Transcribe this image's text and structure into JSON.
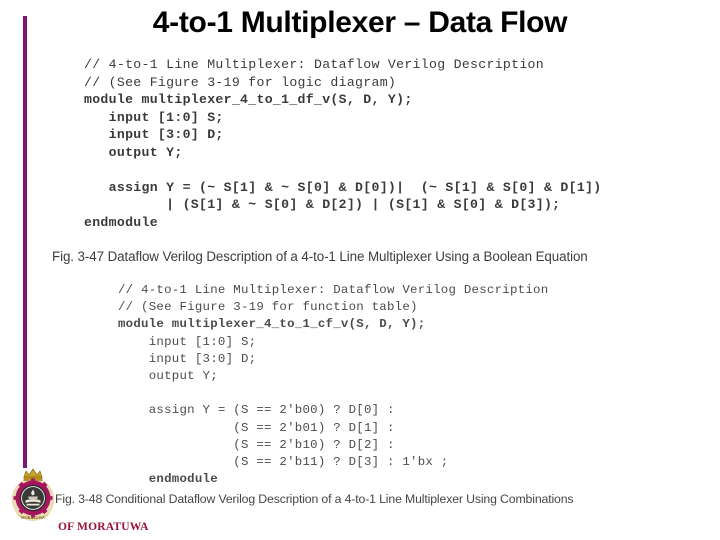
{
  "slide": {
    "title": "4-to-1 Multiplexer – Data Flow",
    "accent_color": "#77177a",
    "background_color": "#ffffff"
  },
  "code_block_1": {
    "caption_ref": "Fig. 3-47",
    "lines": [
      {
        "text": "// 4-to-1 Line Multiplexer: Dataflow Verilog Description",
        "bold": false
      },
      {
        "text": "// (See Figure 3-19 for logic diagram)",
        "bold": false
      },
      {
        "text": "module multiplexer_4_to_1_df_v(S, D, Y);",
        "bold": true
      },
      {
        "text": "   input [1:0] S;",
        "bold": true
      },
      {
        "text": "   input [3:0] D;",
        "bold": true
      },
      {
        "text": "   output Y;",
        "bold": true
      },
      {
        "text": "",
        "bold": false
      },
      {
        "text": "   assign Y = (~ S[1] & ~ S[0] & D[0])|  (~ S[1] & S[0] & D[1])",
        "bold": true
      },
      {
        "text": "          | (S[1] & ~ S[0] & D[2]) | (S[1] & S[0] & D[3]);",
        "bold": true
      },
      {
        "text": "endmodule",
        "bold": true
      }
    ]
  },
  "code_block_2": {
    "caption_ref": "Fig. 3-48",
    "lines": [
      {
        "text": "// 4-to-1 Line Multiplexer: Dataflow Verilog Description",
        "bold": false
      },
      {
        "text": "// (See Figure 3-19 for function table)",
        "bold": false
      },
      {
        "text": "module multiplexer_4_to_1_cf_v(S, D, Y);",
        "bold": true
      },
      {
        "text": "    input [1:0] S;",
        "bold": false
      },
      {
        "text": "    input [3:0] D;",
        "bold": false
      },
      {
        "text": "    output Y;",
        "bold": false
      },
      {
        "text": "",
        "bold": false
      },
      {
        "text": "    assign Y = (S == 2'b00) ? D[0] :",
        "bold": false
      },
      {
        "text": "               (S == 2'b01) ? D[1] :",
        "bold": false
      },
      {
        "text": "               (S == 2'b10) ? D[2] :",
        "bold": false
      },
      {
        "text": "               (S == 2'b11) ? D[3] : 1'bx ;",
        "bold": false
      },
      {
        "text": "    endmodule",
        "bold": true
      }
    ]
  },
  "captions": {
    "fig_347": "Fig. 3-47  Dataflow Verilog Description of a 4-to-1 Line Multiplexer Using a Boolean Equation",
    "fig_348": "Fig. 3-48  Conditional Dataflow Verilog Description of a 4-to-1 Line Multiplexer Using Combinations"
  },
  "footer": {
    "organization": "OF MORATUWA",
    "organization_color": "#9b1239",
    "crest_icon": "university-crest-icon"
  }
}
